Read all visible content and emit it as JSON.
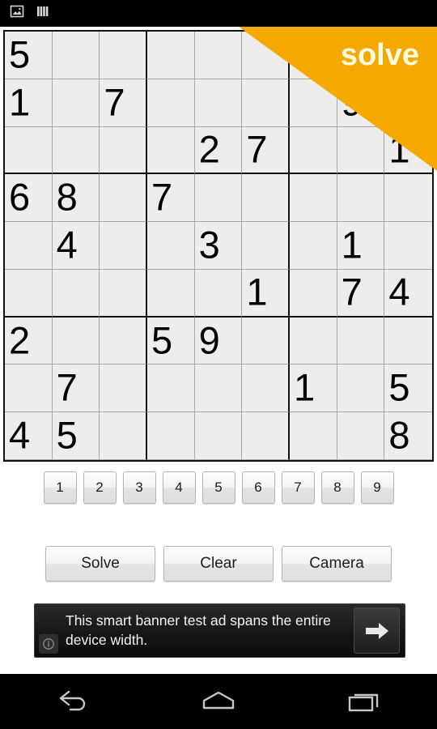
{
  "status_bar": {
    "icons": [
      "screenshot-icon",
      "bars-icon"
    ]
  },
  "ribbon": {
    "label": "solve",
    "color": "#f5a800",
    "text_color": "#fdfbe0"
  },
  "board": {
    "name": "sudoku-grid",
    "rows": [
      [
        "5",
        "",
        "",
        "",
        "",
        "",
        "",
        "",
        ""
      ],
      [
        "1",
        "",
        "7",
        "",
        "",
        "",
        "",
        "9",
        ""
      ],
      [
        "",
        "",
        "",
        "",
        "2",
        "7",
        "",
        "",
        "1"
      ],
      [
        "6",
        "8",
        "",
        "7",
        "",
        "",
        "",
        "",
        ""
      ],
      [
        "",
        "4",
        "",
        "",
        "3",
        "",
        "",
        "1",
        ""
      ],
      [
        "",
        "",
        "",
        "",
        "",
        "1",
        "",
        "7",
        "4"
      ],
      [
        "2",
        "",
        "",
        "5",
        "9",
        "",
        "",
        "",
        ""
      ],
      [
        "",
        "7",
        "",
        "",
        "",
        "",
        "1",
        "",
        "5"
      ],
      [
        "4",
        "5",
        "",
        "",
        "",
        "",
        "",
        "",
        "8"
      ]
    ]
  },
  "number_pad": {
    "buttons": [
      "1",
      "2",
      "3",
      "4",
      "5",
      "6",
      "7",
      "8",
      "9"
    ]
  },
  "actions": {
    "solve_label": "Solve",
    "clear_label": "Clear",
    "camera_label": "Camera"
  },
  "ad": {
    "text": "This smart banner test ad spans the entire device width.",
    "info_glyph": "ⓘ",
    "arrow_name": "arrow-right-icon"
  },
  "nav_bar": {
    "back": "back-icon",
    "home": "home-icon",
    "recents": "recent-apps-icon"
  }
}
